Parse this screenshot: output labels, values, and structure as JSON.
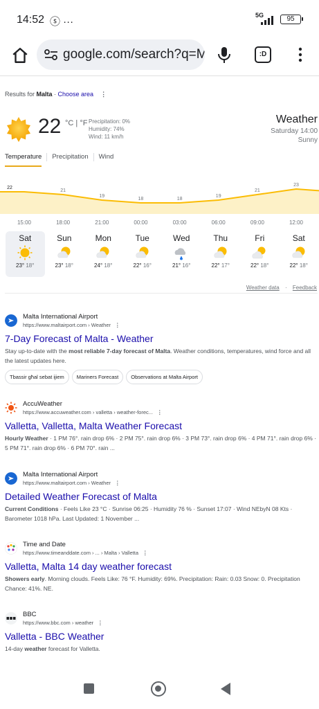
{
  "status": {
    "time": "14:52",
    "left_icons": "ⓢ ···",
    "network": "5G",
    "battery": "95"
  },
  "browser": {
    "url": "google.com/search?q=M",
    "tabs_count": ":D"
  },
  "results_for": {
    "prefix": "Results for ",
    "place": "Malta",
    "sep": " · ",
    "choose_area": "Choose area",
    "more": "⋮"
  },
  "weather": {
    "temperature": "22",
    "units": "°C | °F",
    "precipitation": "Precipitation: 0%",
    "humidity": "Humidity: 74%",
    "wind": "Wind: 11 km/h",
    "title": "Weather",
    "when": "Saturday 14:00",
    "condition": "Sunny",
    "tabs": [
      "Temperature",
      "Precipitation",
      "Wind"
    ],
    "links": {
      "data": "Weather data",
      "sep": "·",
      "feedback": "Feedback"
    },
    "days": [
      {
        "name": "Sat",
        "icon": "sun-icon",
        "hi": "23°",
        "lo": "18°"
      },
      {
        "name": "Sun",
        "icon": "partly-cloudy-icon",
        "hi": "23°",
        "lo": "18°"
      },
      {
        "name": "Mon",
        "icon": "partly-cloudy-icon",
        "hi": "24°",
        "lo": "18°"
      },
      {
        "name": "Tue",
        "icon": "partly-cloudy-icon",
        "hi": "22°",
        "lo": "16°"
      },
      {
        "name": "Wed",
        "icon": "rain-cloud-icon",
        "hi": "21°",
        "lo": "16°"
      },
      {
        "name": "Thu",
        "icon": "partly-cloudy-icon",
        "hi": "22°",
        "lo": "17°"
      },
      {
        "name": "Fri",
        "icon": "cloudy-sun-icon",
        "hi": "22°",
        "lo": "18°"
      },
      {
        "name": "Sat",
        "icon": "partly-cloudy-icon",
        "hi": "22°",
        "lo": "18°"
      }
    ]
  },
  "chart_data": {
    "type": "area",
    "x": [
      "15:00",
      "18:00",
      "21:00",
      "00:00",
      "03:00",
      "06:00",
      "09:00",
      "12:00"
    ],
    "labels": [
      {
        "t": 15.0,
        "v": 22,
        "text": "22"
      },
      {
        "t": 18.0,
        "v": 21,
        "text": "21"
      },
      {
        "t": 21.0,
        "v": 19,
        "text": "19"
      },
      {
        "t": 24.0,
        "v": 18,
        "text": "18"
      },
      {
        "t": 27.0,
        "v": 18,
        "text": "18"
      },
      {
        "t": 30.0,
        "v": 19,
        "text": "19"
      },
      {
        "t": 33.0,
        "v": 21,
        "text": "21"
      },
      {
        "t": 36.0,
        "v": 23,
        "text": "23"
      }
    ],
    "ylim": [
      14,
      26
    ],
    "color": "#fbbc04"
  },
  "results": [
    {
      "site": "Malta International Airport",
      "url": "https://www.maltairport.com › Weather",
      "title": "7-Day Forecast of Malta - Weather",
      "snippet_parts": [
        "Stay up-to-date with the ",
        "most reliable 7-day forecast of Malta",
        ". Weather conditions, temperatures, wind force and all the latest updates here."
      ],
      "chips": [
        "Tbassir għal sebat ijiem",
        "Mariners Forecast",
        "Observations at Malta Airport"
      ]
    },
    {
      "site": "AccuWeather",
      "url": "https://www.accuweather.com › valletta › weather-forec...",
      "title": "Valletta, Valletta, Malta Weather Forecast",
      "snippet_parts": [
        "Hourly Weather",
        " · 1 PM 76°. rain drop 6% · 2 PM 75°. rain drop 6% · 3 PM 73°. rain drop 6% · 4 PM 71°. rain drop 6% · 5 PM 71°. rain drop 6% · 6 PM 70°. rain ..."
      ]
    },
    {
      "site": "Malta International Airport",
      "url": "https://www.maltairport.com › Weather",
      "title": "Detailed Weather Forecast of Malta",
      "snippet_parts": [
        "Current Conditions",
        " · Feels Like 23 °C · Sunrise 06:25 · Humidity 76 % · Sunset 17:07 · Wind NEbyN 08 Kts · Barometer 1018 hPa. Last Updated: 1 November ..."
      ]
    },
    {
      "site": "Time and Date",
      "url": "https://www.timeanddate.com › ... › Malta › Valletta",
      "title": "Valletta, Malta 14 day weather forecast",
      "snippet_parts": [
        "Showers early",
        ". Morning clouds. Feels Like: 76 °F. Humidity: 69%. Precipitation: Rain: 0.03 Snow: 0. Precipitation Chance: 41%. NE."
      ]
    },
    {
      "site": "BBC",
      "url": "https://www.bbc.com › weather",
      "title": "Valletta - BBC Weather",
      "snippet_parts": [
        "14-day ",
        "weather",
        " forecast for Valletta."
      ]
    }
  ],
  "colors": {
    "link": "#1a0dab",
    "sun": "#fbbc04",
    "tab_underline": "#e8a91a"
  }
}
